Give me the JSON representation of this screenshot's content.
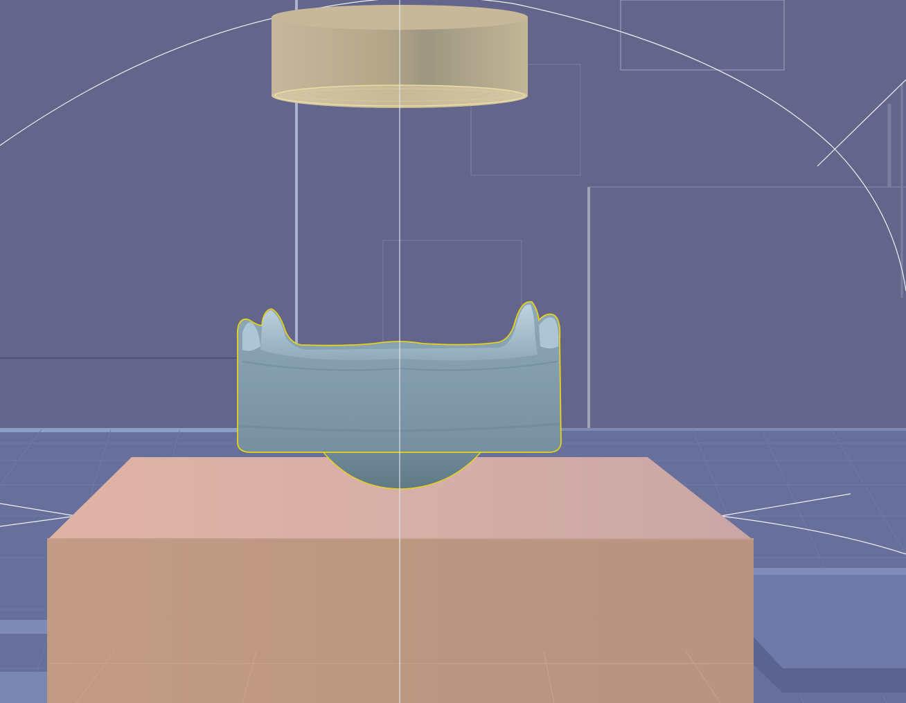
{
  "viewport": {
    "background_color": "#63668a",
    "selection_outline_color": "#e8d21a",
    "gizmo_line_color": "#ffffff"
  },
  "scene": {
    "objects": [
      {
        "name": "ring-object",
        "color": "#b8ab8f",
        "selected": false
      },
      {
        "name": "dental-mold-object",
        "color": "#7f9aa8",
        "selected": true
      },
      {
        "name": "base-block-object",
        "color": "#bf9a86",
        "selected": false
      }
    ],
    "floor_grid": {
      "visible": true,
      "color": "#7c83ad"
    }
  }
}
